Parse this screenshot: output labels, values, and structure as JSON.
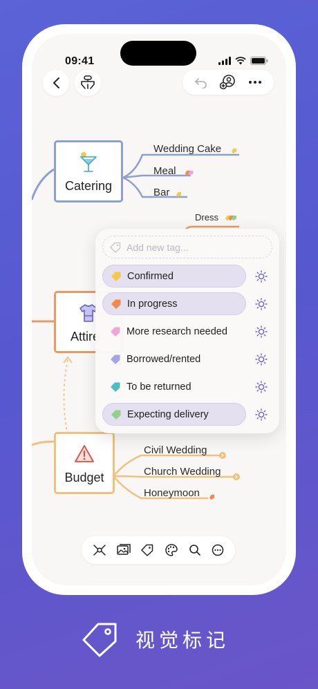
{
  "status_bar": {
    "time": "09:41"
  },
  "mindmap": {
    "catering": {
      "label": "Catering",
      "children": [
        "Wedding Cake",
        "Meal",
        "Bar"
      ]
    },
    "attire": {
      "label": "Attire",
      "children": [
        "Dress"
      ]
    },
    "budget": {
      "label": "Budget",
      "children": [
        "Civil Wedding",
        "Church Wedding",
        "Honeymoon"
      ]
    }
  },
  "tag_popup": {
    "placeholder": "Add new tag...",
    "tags": [
      {
        "label": "Confirmed",
        "color": "#f5c84e",
        "selected": true
      },
      {
        "label": "In progress",
        "color": "#f08a4e",
        "selected": true
      },
      {
        "label": "More research needed",
        "color": "#f0a6d8",
        "selected": false
      },
      {
        "label": "Borrowed/rented",
        "color": "#a6a4ea",
        "selected": false
      },
      {
        "label": "To be returned",
        "color": "#4fbcc4",
        "selected": false
      },
      {
        "label": "Expecting delivery",
        "color": "#8fd08a",
        "selected": true
      }
    ]
  },
  "footer": {
    "caption": "视觉标记"
  },
  "colors": {
    "catering_branch": "#8d9fcf",
    "attire_branch": "#e89a64",
    "budget_branch": "#f1c07a",
    "accent": "#6b5fd0"
  }
}
